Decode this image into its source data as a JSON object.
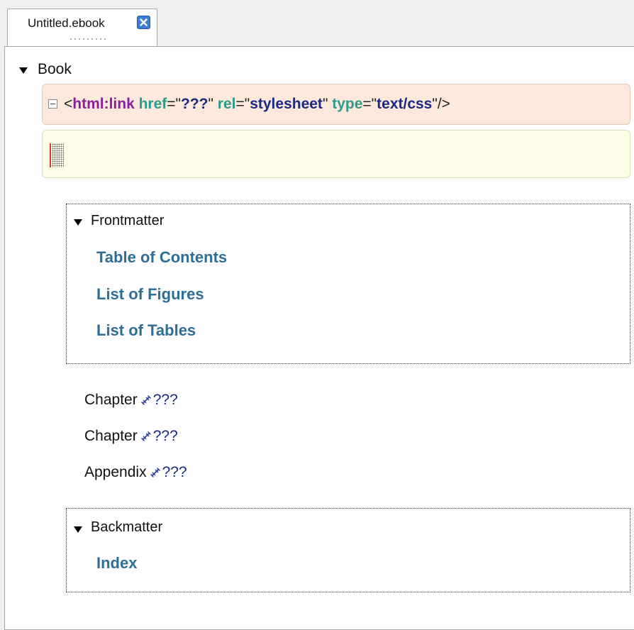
{
  "tab": {
    "title": "Untitled.ebook"
  },
  "book": {
    "label": "Book"
  },
  "link_element": {
    "open": "<",
    "tag": "html:link",
    "href_attr": "href",
    "href_value": "???",
    "rel_attr": "rel",
    "rel_value": "stylesheet",
    "type_attr": "type",
    "type_value": "text/css",
    "close": "/>"
  },
  "frontmatter": {
    "title": "Frontmatter",
    "items": [
      "Table of Contents",
      "List of Figures",
      "List of Tables"
    ]
  },
  "chapters": [
    {
      "label": "Chapter",
      "value": "???"
    },
    {
      "label": "Chapter",
      "value": "???"
    },
    {
      "label": "Appendix",
      "value": "???"
    }
  ],
  "backmatter": {
    "title": "Backmatter",
    "items": [
      "Index"
    ]
  },
  "colors": {
    "element_name": "#8a1f9e",
    "attribute_name": "#2f9a8a",
    "attribute_value": "#1a2a80",
    "nav_link": "#2e6d96",
    "link_row_bg": "#fde9db",
    "input_row_bg": "#fefde8"
  }
}
